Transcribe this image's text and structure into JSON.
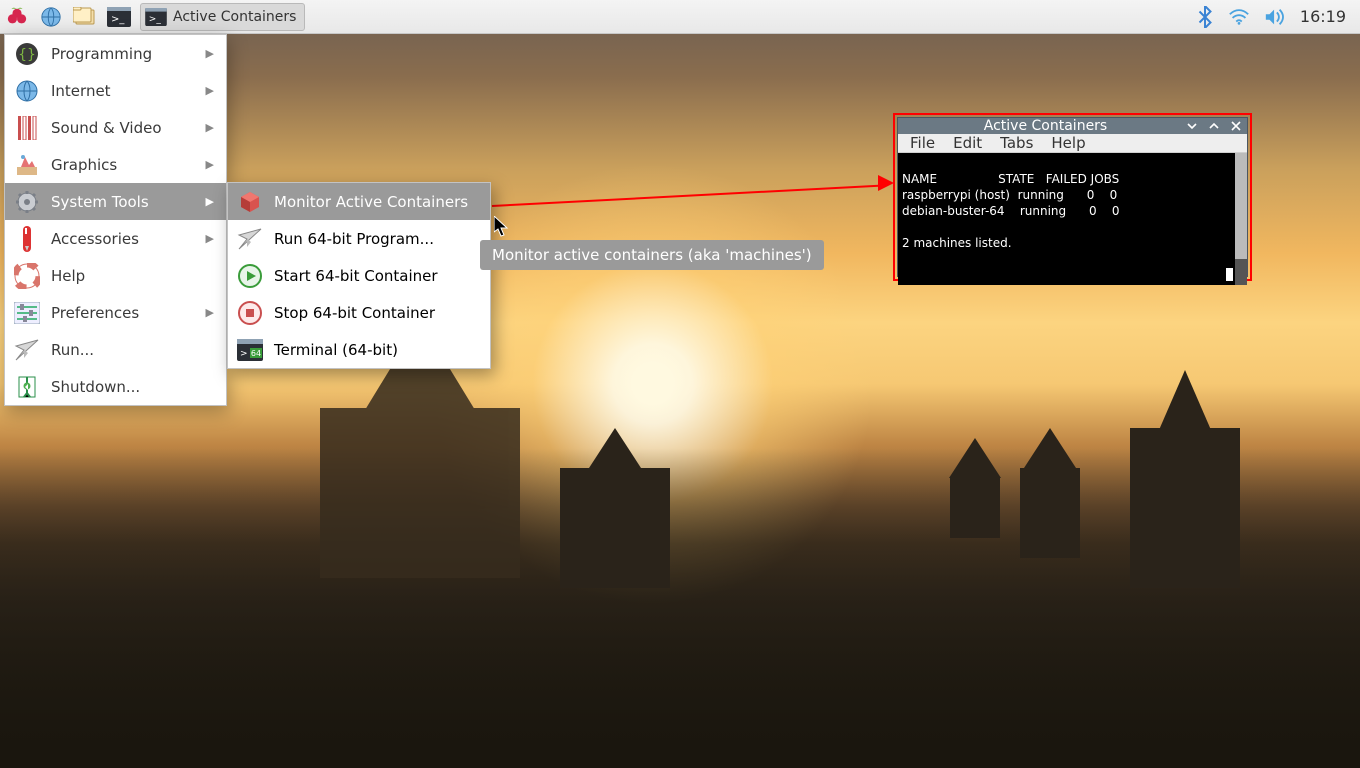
{
  "panel": {
    "task_label": "Active Containers",
    "clock": "16:19"
  },
  "menu": {
    "items": [
      {
        "label": "Programming",
        "icon": "programming-icon",
        "sub": true
      },
      {
        "label": "Internet",
        "icon": "internet-icon",
        "sub": true
      },
      {
        "label": "Sound & Video",
        "icon": "sound-video-icon",
        "sub": true
      },
      {
        "label": "Graphics",
        "icon": "graphics-icon",
        "sub": true
      },
      {
        "label": "System Tools",
        "icon": "system-tools-icon",
        "sub": true,
        "hover": true
      },
      {
        "label": "Accessories",
        "icon": "accessories-icon",
        "sub": true
      },
      {
        "label": "Help",
        "icon": "help-icon",
        "sub": false
      },
      {
        "label": "Preferences",
        "icon": "preferences-icon",
        "sub": true
      },
      {
        "label": "Run...",
        "icon": "run-icon",
        "sub": false
      },
      {
        "label": "Shutdown...",
        "icon": "shutdown-icon",
        "sub": false
      }
    ]
  },
  "submenu": {
    "items": [
      {
        "label": "Monitor Active Containers",
        "icon": "container-icon",
        "hover": true
      },
      {
        "label": "Run 64-bit Program...",
        "icon": "send-icon"
      },
      {
        "label": "Start 64-bit Container",
        "icon": "play-icon"
      },
      {
        "label": "Stop 64-bit Container",
        "icon": "stop-icon"
      },
      {
        "label": "Terminal (64-bit)",
        "icon": "terminal64-icon"
      }
    ]
  },
  "tooltip": "Monitor active containers (aka 'machines')",
  "window": {
    "title": "Active Containers",
    "menubar": [
      "File",
      "Edit",
      "Tabs",
      "Help"
    ],
    "terminal_header": "NAME                STATE   FAILED JOBS",
    "terminal_rows": [
      "raspberrypi (host)  running      0    0",
      "debian-buster-64    running      0    0"
    ],
    "terminal_footer": "2 machines listed."
  }
}
